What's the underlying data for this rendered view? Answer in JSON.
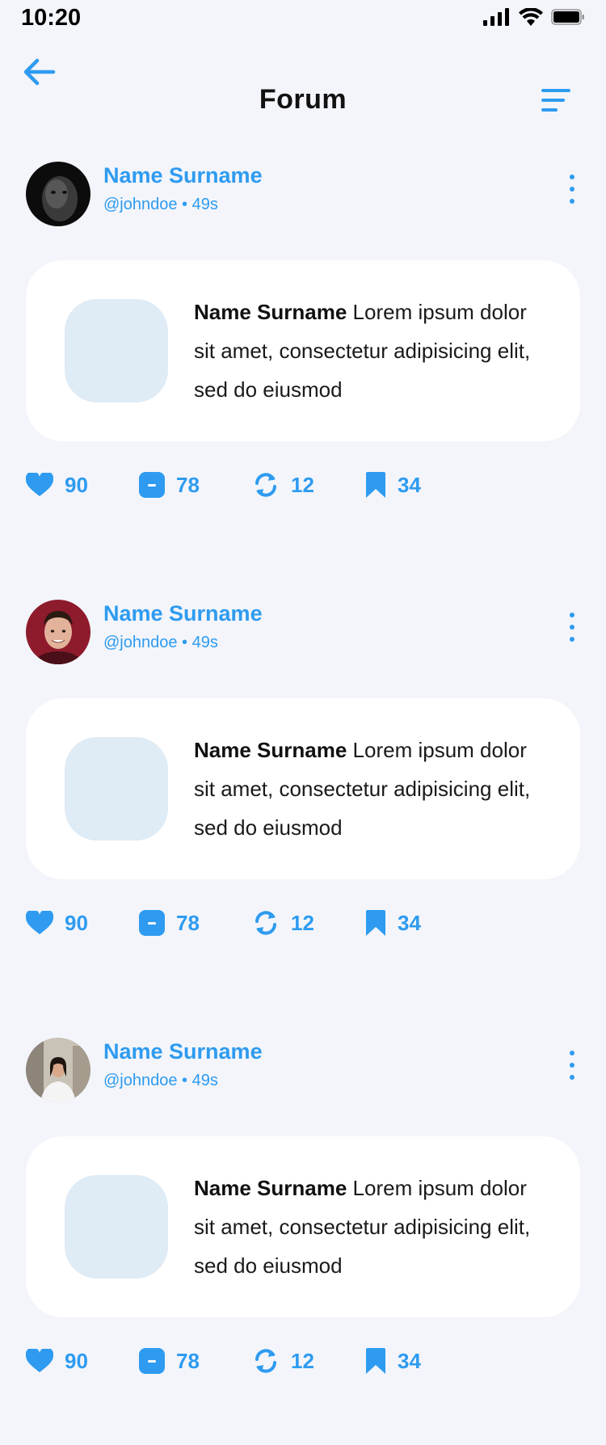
{
  "status_bar": {
    "time": "10:20"
  },
  "header": {
    "title": "Forum"
  },
  "posts": [
    {
      "author_name": "Name Surname",
      "author_meta": "@johndoe • 49s",
      "text_author": "Name Surname",
      "text_body": " Lorem ipsum dolor sit amet, consectetur adipisicing elit, sed do eiusmod",
      "likes": "90",
      "comments": "78",
      "reposts": "12",
      "saves": "34"
    },
    {
      "author_name": "Name Surname",
      "author_meta": "@johndoe • 49s",
      "text_author": "Name Surname",
      "text_body": " Lorem ipsum dolor sit amet, consectetur adipisicing elit, sed do eiusmod",
      "likes": "90",
      "comments": "78",
      "reposts": "12",
      "saves": "34"
    },
    {
      "author_name": "Name Surname",
      "author_meta": "@johndoe • 49s",
      "text_author": "Name Surname",
      "text_body": " Lorem ipsum dolor sit amet, consectetur adipisicing elit, sed do eiusmod",
      "likes": "90",
      "comments": "78",
      "reposts": "12",
      "saves": "34"
    }
  ],
  "colors": {
    "accent": "#2E9BF0",
    "background": "#F3F5FB",
    "card": "#FFFFFF",
    "thumb": "#DFEBF5"
  },
  "icons": [
    "back-arrow-icon",
    "filter-icon",
    "more-icon",
    "heart-icon",
    "comment-icon",
    "repost-icon",
    "bookmark-icon"
  ]
}
